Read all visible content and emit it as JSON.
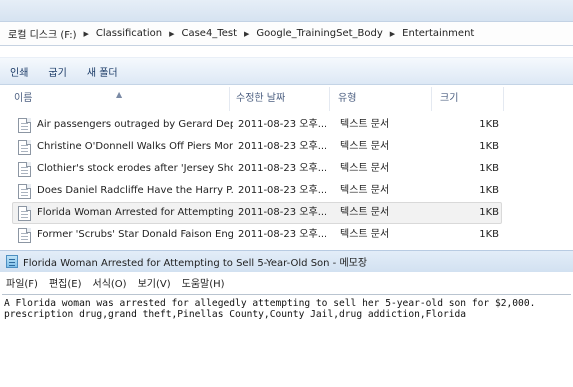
{
  "explorer": {
    "breadcrumb": [
      "로컬 디스크 (F:)",
      "Classification",
      "Case4_Test",
      "Google_TrainingSet_Body",
      "Entertainment"
    ],
    "commands": {
      "print": "인쇄",
      "burn": "굽기",
      "new_folder": "새 폴더"
    },
    "columns": {
      "name": "이름",
      "modified": "수정한 날짜",
      "type": "유형",
      "size": "크기"
    },
    "files": [
      {
        "name": "Air passengers outraged by Gerard Depa...",
        "modified": "2011-08-23 오후...",
        "type": "텍스트 문서",
        "size": "1KB"
      },
      {
        "name": "Christine O'Donnell Walks Off Piers Mor...",
        "modified": "2011-08-23 오후...",
        "type": "텍스트 문서",
        "size": "1KB"
      },
      {
        "name": "Clothier's stock erodes after 'Jersey Shor...",
        "modified": "2011-08-23 오후...",
        "type": "텍스트 문서",
        "size": "1KB"
      },
      {
        "name": "Does Daniel Radcliffe Have the Harry P...",
        "modified": "2011-08-23 오후...",
        "type": "텍스트 문서",
        "size": "1KB"
      },
      {
        "name": "Florida Woman Arrested for Attempting...",
        "modified": "2011-08-23 오후...",
        "type": "텍스트 문서",
        "size": "1KB"
      },
      {
        "name": "Former 'Scrubs' Star Donald Faison Eng...",
        "modified": "2011-08-23 오후...",
        "type": "텍스트 문서",
        "size": "1KB"
      }
    ],
    "selected_index": 4
  },
  "notepad": {
    "title": "Florida Woman Arrested for Attempting to Sell 5-Year-Old Son - 메모장",
    "menus": [
      "파일(F)",
      "편집(E)",
      "서식(O)",
      "보기(V)",
      "도움말(H)"
    ],
    "content_line1": "A Florida woman was arrested for allegedly attempting to sell her 5-year-old son for $2,000.",
    "content_line2": "prescription drug,grand theft,Pinellas County,County Jail,drug addiction,Florida"
  },
  "icons": {
    "file": "text-file-icon",
    "notepad": "notepad-icon",
    "breadcrumb_separator": "chevron-right-icon",
    "sort": "sort-up-icon"
  }
}
